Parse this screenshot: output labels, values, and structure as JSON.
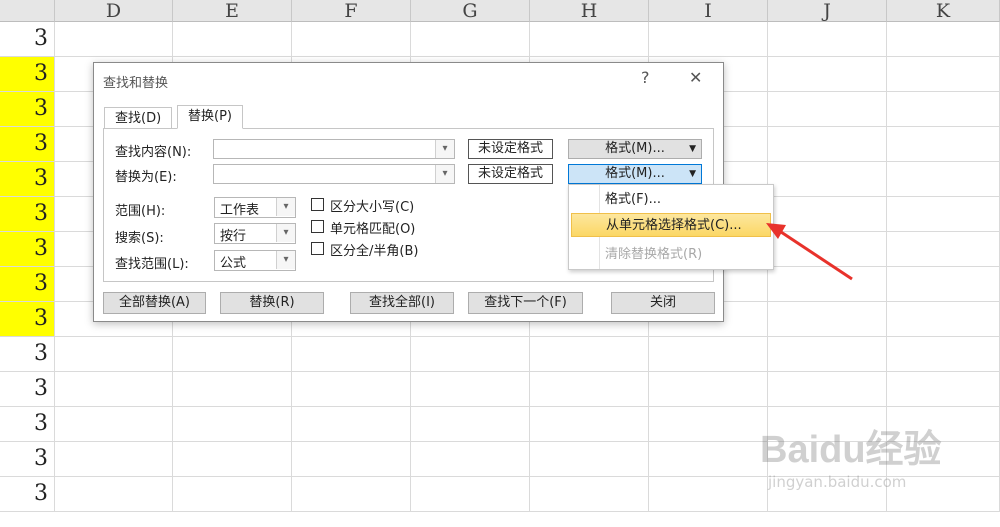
{
  "sheet": {
    "columns": [
      "D",
      "E",
      "F",
      "G",
      "H",
      "I",
      "J",
      "K"
    ],
    "cell_value": "3",
    "rows": [
      {
        "value": "3",
        "highlight": false
      },
      {
        "value": "3",
        "highlight": true
      },
      {
        "value": "3",
        "highlight": true
      },
      {
        "value": "3",
        "highlight": true
      },
      {
        "value": "3",
        "highlight": true
      },
      {
        "value": "3",
        "highlight": true
      },
      {
        "value": "3",
        "highlight": true
      },
      {
        "value": "3",
        "highlight": true
      },
      {
        "value": "3",
        "highlight": true
      },
      {
        "value": "3",
        "highlight": false
      },
      {
        "value": "3",
        "highlight": false
      },
      {
        "value": "3",
        "highlight": false
      },
      {
        "value": "3",
        "highlight": false
      },
      {
        "value": "3",
        "highlight": false
      }
    ],
    "highlight_color": "#ffff00"
  },
  "dialog": {
    "title": "查找和替换",
    "help": "?",
    "close": "✕",
    "tabs": {
      "find": "查找(D)",
      "replace": "替换(P)"
    },
    "find_label": "查找内容(N):",
    "replace_label": "替换为(E):",
    "find_value": "",
    "replace_value": "",
    "no_format_1": "未设定格式",
    "no_format_2": "未设定格式",
    "format_btn_1": "格式(M)...",
    "format_btn_2": "格式(M)...",
    "scope_label": "范围(H):",
    "scope_value": "工作表",
    "search_label": "搜索(S):",
    "search_value": "按行",
    "lookin_label": "查找范围(L):",
    "lookin_value": "公式",
    "match_case": "区分大小写(C)",
    "match_cell": "单元格匹配(O)",
    "match_width": "区分全/半角(B)",
    "buttons": {
      "replace_all": "全部替换(A)",
      "replace": "替换(R)",
      "find_all": "查找全部(I)",
      "find_next": "查找下一个(F)",
      "close": "关闭"
    }
  },
  "menu": {
    "format": "格式(F)...",
    "choose_from_cell": "从单元格选择格式(C)...",
    "clear_format": "清除替换格式(R)"
  },
  "watermark": {
    "logo": "Baidu经验",
    "url": "jingyan.baidu.com"
  }
}
